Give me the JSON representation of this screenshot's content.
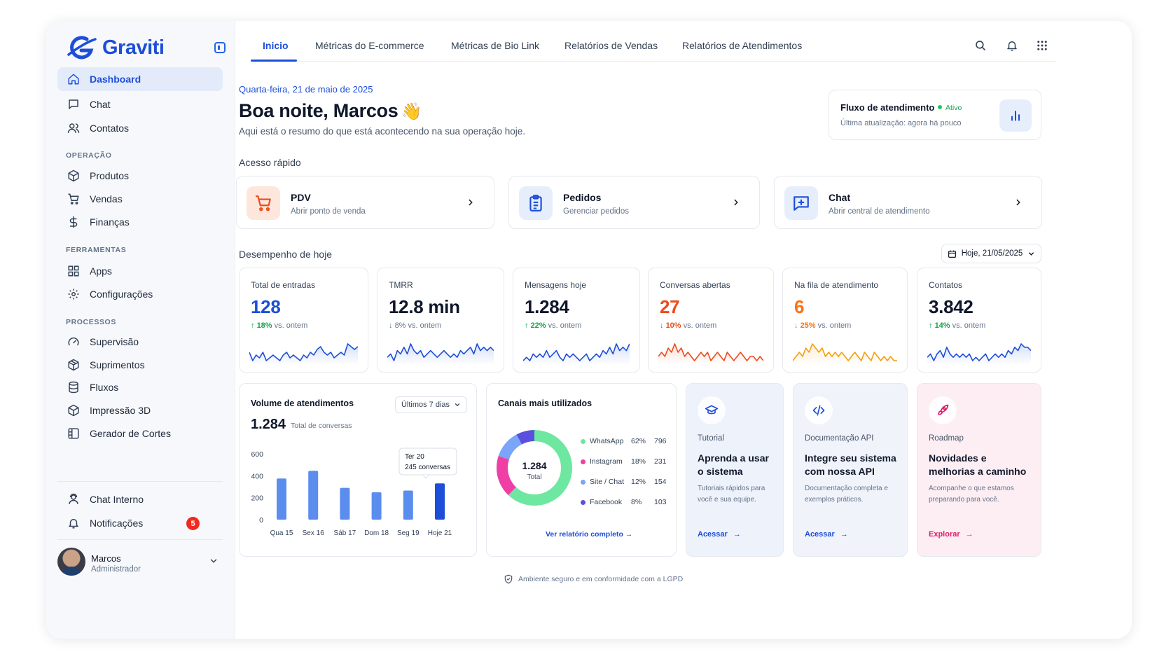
{
  "brand": {
    "name": "Graviti",
    "color": "#1d4ed8"
  },
  "sidebar": {
    "primary": [
      {
        "label": "Dashboard",
        "icon": "home-icon",
        "active": true
      },
      {
        "label": "Chat",
        "icon": "chat-icon"
      },
      {
        "label": "Contatos",
        "icon": "users-icon"
      }
    ],
    "sections": [
      {
        "title": "OPERAÇÃO",
        "items": [
          {
            "label": "Produtos",
            "icon": "box-icon"
          },
          {
            "label": "Vendas",
            "icon": "cart-icon"
          },
          {
            "label": "Finanças",
            "icon": "dollar-icon"
          }
        ]
      },
      {
        "title": "FERRAMENTAS",
        "items": [
          {
            "label": "Apps",
            "icon": "grid-icon"
          },
          {
            "label": "Configurações",
            "icon": "gear-icon"
          }
        ]
      },
      {
        "title": "PROCESSOS",
        "items": [
          {
            "label": "Supervisão",
            "icon": "gauge-icon"
          },
          {
            "label": "Suprimentos",
            "icon": "package-icon"
          },
          {
            "label": "Fluxos",
            "icon": "database-icon"
          },
          {
            "label": "Impressão 3D",
            "icon": "cube-icon"
          },
          {
            "label": "Gerador de Cortes",
            "icon": "layout-icon"
          }
        ]
      }
    ],
    "bottom": [
      {
        "label": "Chat Interno",
        "icon": "headset-icon"
      },
      {
        "label": "Notificações",
        "icon": "bell-icon",
        "badge": "5"
      }
    ],
    "user": {
      "name": "Marcos",
      "role": "Administrador"
    }
  },
  "tabs": [
    {
      "label": "Inicio",
      "active": true
    },
    {
      "label": "Métricas do E-commerce"
    },
    {
      "label": "Métricas de Bio Link"
    },
    {
      "label": "Relatórios de Vendas"
    },
    {
      "label": "Relatórios de Atendimentos"
    }
  ],
  "header": {
    "date": "Quarta-feira, 21 de maio de 2025",
    "greeting": "Boa noite, Marcos",
    "wave": "👋",
    "summary": "Aqui está o resumo do que está acontecendo na sua operação hoje."
  },
  "flow": {
    "title": "Fluxo de atendimento",
    "status": "Ativo",
    "updated": "Última atualização: agora há pouco"
  },
  "quick_access": {
    "title": "Acesso rápido",
    "items": [
      {
        "title": "PDV",
        "subtitle": "Abrir ponto de venda",
        "icon": "cart-icon"
      },
      {
        "title": "Pedidos",
        "subtitle": "Gerenciar pedidos",
        "icon": "clipboard-icon"
      },
      {
        "title": "Chat",
        "subtitle": "Abrir central de atendimento",
        "icon": "chat-plus-icon"
      }
    ]
  },
  "performance": {
    "title": "Desempenho de hoje",
    "date_filter": "Hoje, 21/05/2025",
    "stats": [
      {
        "label": "Total de entradas",
        "value": "128",
        "delta": "18%",
        "trend": "up",
        "vs": "vs. ontem",
        "value_color": "#1d4ed8",
        "line_color": "#1d4ed8",
        "spark": [
          6,
          3,
          5,
          4,
          6,
          3,
          4,
          5,
          4,
          3,
          5,
          6,
          4,
          5,
          4,
          3,
          5,
          4,
          6,
          5,
          7,
          8,
          6,
          5,
          6,
          4,
          5,
          6,
          5,
          9,
          8,
          7,
          8
        ]
      },
      {
        "label": "TMRR",
        "value": "12.8 min",
        "delta": "8%",
        "trend": "down",
        "vs": "vs. ontem",
        "value_color": "#0f172a",
        "line_color": "#1d4ed8",
        "spark": [
          4,
          5,
          3,
          6,
          5,
          7,
          5,
          8,
          6,
          5,
          6,
          4,
          5,
          6,
          5,
          4,
          5,
          6,
          5,
          4,
          5,
          4,
          6,
          5,
          6,
          7,
          5,
          8,
          6,
          7,
          6,
          7,
          6
        ]
      },
      {
        "label": "Mensagens hoje",
        "value": "1.284",
        "delta": "22%",
        "trend": "up",
        "vs": "vs. ontem",
        "value_color": "#0f172a",
        "line_color": "#1d4ed8",
        "spark": [
          4,
          5,
          4,
          6,
          5,
          6,
          5,
          7,
          5,
          6,
          7,
          5,
          4,
          6,
          5,
          6,
          5,
          4,
          5,
          6,
          4,
          5,
          6,
          5,
          7,
          6,
          8,
          6,
          9,
          7,
          8,
          7,
          9
        ]
      },
      {
        "label": "Conversas abertas",
        "value": "27",
        "delta": "10%",
        "trend": "down",
        "vs": "vs. ontem",
        "value_color": "#ef4a1a",
        "line_color": "#ef4a1a",
        "spark": [
          5,
          6,
          5,
          7,
          6,
          8,
          6,
          7,
          5,
          6,
          5,
          4,
          5,
          6,
          5,
          6,
          4,
          5,
          6,
          5,
          4,
          6,
          5,
          4,
          5,
          6,
          5,
          4,
          5,
          5,
          4,
          5,
          4
        ]
      },
      {
        "label": "Na fila de atendimento",
        "value": "6",
        "delta": "25%",
        "trend": "down",
        "vs": "vs. ontem",
        "value_color": "#f97316",
        "line_color": "#f59e0b",
        "spark": [
          4,
          5,
          6,
          5,
          7,
          6,
          8,
          7,
          6,
          7,
          5,
          6,
          5,
          6,
          5,
          6,
          5,
          4,
          5,
          6,
          5,
          4,
          6,
          5,
          4,
          6,
          5,
          4,
          5,
          4,
          5,
          4,
          4
        ]
      },
      {
        "label": "Contatos",
        "value": "3.842",
        "delta": "14%",
        "trend": "up",
        "vs": "vs. ontem",
        "value_color": "#0f172a",
        "line_color": "#1d4ed8",
        "spark": [
          5,
          6,
          4,
          6,
          7,
          5,
          8,
          6,
          5,
          6,
          5,
          6,
          5,
          6,
          4,
          5,
          4,
          5,
          6,
          4,
          5,
          6,
          5,
          6,
          5,
          7,
          6,
          8,
          7,
          9,
          8,
          8,
          7
        ]
      }
    ]
  },
  "volume": {
    "title": "Volume de atendimentos",
    "range": "Últimos 7 dias",
    "total": "1.284",
    "total_label": "Total de conversas",
    "tooltip": {
      "title": "Ter 20",
      "value": "245 conversas"
    },
    "chart_data": {
      "type": "bar",
      "categories": [
        "Qua 15",
        "Sex 16",
        "Sáb 17",
        "Dom 18",
        "Seg 19",
        "Hoje 21"
      ],
      "values": [
        375,
        445,
        290,
        250,
        265,
        330
      ],
      "ylim": [
        0,
        600
      ],
      "yticks": [
        "600",
        "400",
        "200",
        "0"
      ],
      "highlight_index": 5,
      "bar_color": "#5b8def",
      "highlight_color": "#1d4ed8"
    }
  },
  "channels": {
    "title": "Canais mais utilizados",
    "total_value": "1.284",
    "total_label": "Total",
    "link": "Ver relatório completo",
    "chart_data": {
      "type": "pie",
      "categories": [
        "WhatsApp",
        "Instagram",
        "Site / Chat",
        "Facebook"
      ],
      "values": [
        62,
        18,
        12,
        8
      ],
      "percent_labels": [
        "62%",
        "18%",
        "12%",
        "8%"
      ],
      "counts": [
        "796",
        "231",
        "154",
        "103"
      ],
      "colors": [
        "#6ee7a0",
        "#ef3fa5",
        "#7aa5f8",
        "#5b4fe0"
      ]
    }
  },
  "promos": [
    {
      "kicker": "Tutorial",
      "title": "Aprenda a usar o sistema",
      "desc": "Tutoriais rápidos para você e sua equipe.",
      "link": "Acessar",
      "icon": "graduation-cap-icon",
      "bg": "#eef2fb",
      "accent": "#1d4ed8"
    },
    {
      "kicker": "Documentação API",
      "title": "Integre seu sistema com nossa API",
      "desc": "Documentação completa e exemplos práticos.",
      "link": "Acessar",
      "icon": "code-icon",
      "bg": "#f0f3fa",
      "accent": "#1d4ed8"
    },
    {
      "kicker": "Roadmap",
      "title": "Novidades e melhorias a caminho",
      "desc": "Acompanhe o que estamos preparando para você.",
      "link": "Explorar",
      "icon": "rocket-icon",
      "bg": "#fdeef3",
      "accent": "#e11d6a"
    }
  ],
  "footer": {
    "text": "Ambiente seguro e em conformidade com a LGPD"
  }
}
